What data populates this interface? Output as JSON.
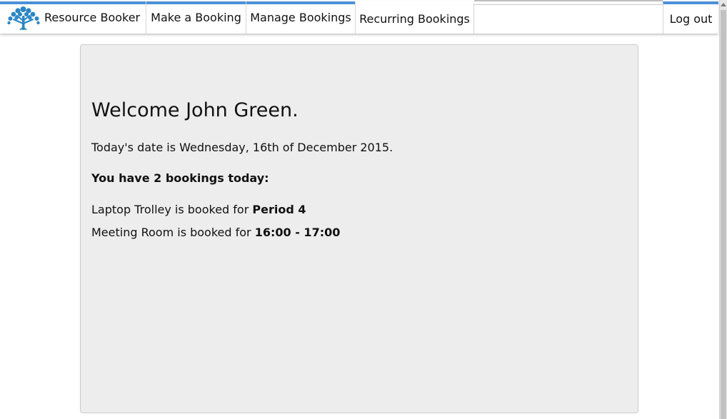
{
  "nav": {
    "brand": "Resource Booker",
    "make_booking": "Make a Booking",
    "manage_bookings": "Manage Bookings",
    "recurring_bookings": "Recurring Bookings",
    "logout": "Log out",
    "logo_icon": "tree-logo-icon"
  },
  "colors": {
    "accent": "#4a90d9",
    "panel_bg": "#ededed",
    "logo": "#2b86c5"
  },
  "main": {
    "welcome": "Welcome John Green.",
    "date_text": "Today's date is Wednesday, 16th of December 2015.",
    "summary": "You have 2 bookings today:",
    "bookings": [
      {
        "resource_text": "Laptop Trolley is booked for ",
        "time": "Period 4"
      },
      {
        "resource_text": "Meeting Room is booked for ",
        "time": "16:00 - 17:00"
      }
    ]
  }
}
